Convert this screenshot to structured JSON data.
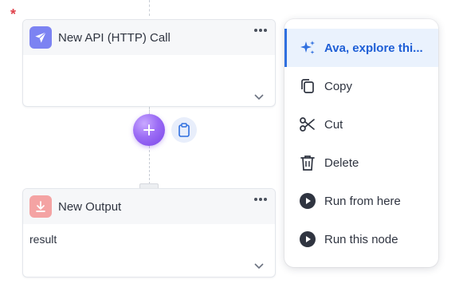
{
  "workflow": {
    "required_marker": "*",
    "nodes": [
      {
        "title": "New API (HTTP) Call",
        "icon": "paper-plane-icon",
        "icon_bg": "#7c83f2",
        "body": ""
      },
      {
        "title": "New Output",
        "icon": "download-icon",
        "icon_bg": "#f4a3a3",
        "body": "result"
      }
    ],
    "add_button_icon": "plus-icon",
    "paste_button_icon": "clipboard-icon"
  },
  "context_menu": {
    "items": [
      {
        "label": "Ava, explore thi...",
        "icon": "sparkles-icon",
        "active": true
      },
      {
        "label": "Copy",
        "icon": "copy-icon",
        "active": false
      },
      {
        "label": "Cut",
        "icon": "scissors-icon",
        "active": false
      },
      {
        "label": "Delete",
        "icon": "trash-icon",
        "active": false
      },
      {
        "label": "Run from here",
        "icon": "play-circle-icon",
        "active": false
      },
      {
        "label": "Run this node",
        "icon": "play-circle-icon",
        "active": false
      }
    ]
  },
  "colors": {
    "accent": "#2f6fdf",
    "plus_gradient": "#9b6cf5",
    "required": "#e0414b"
  }
}
